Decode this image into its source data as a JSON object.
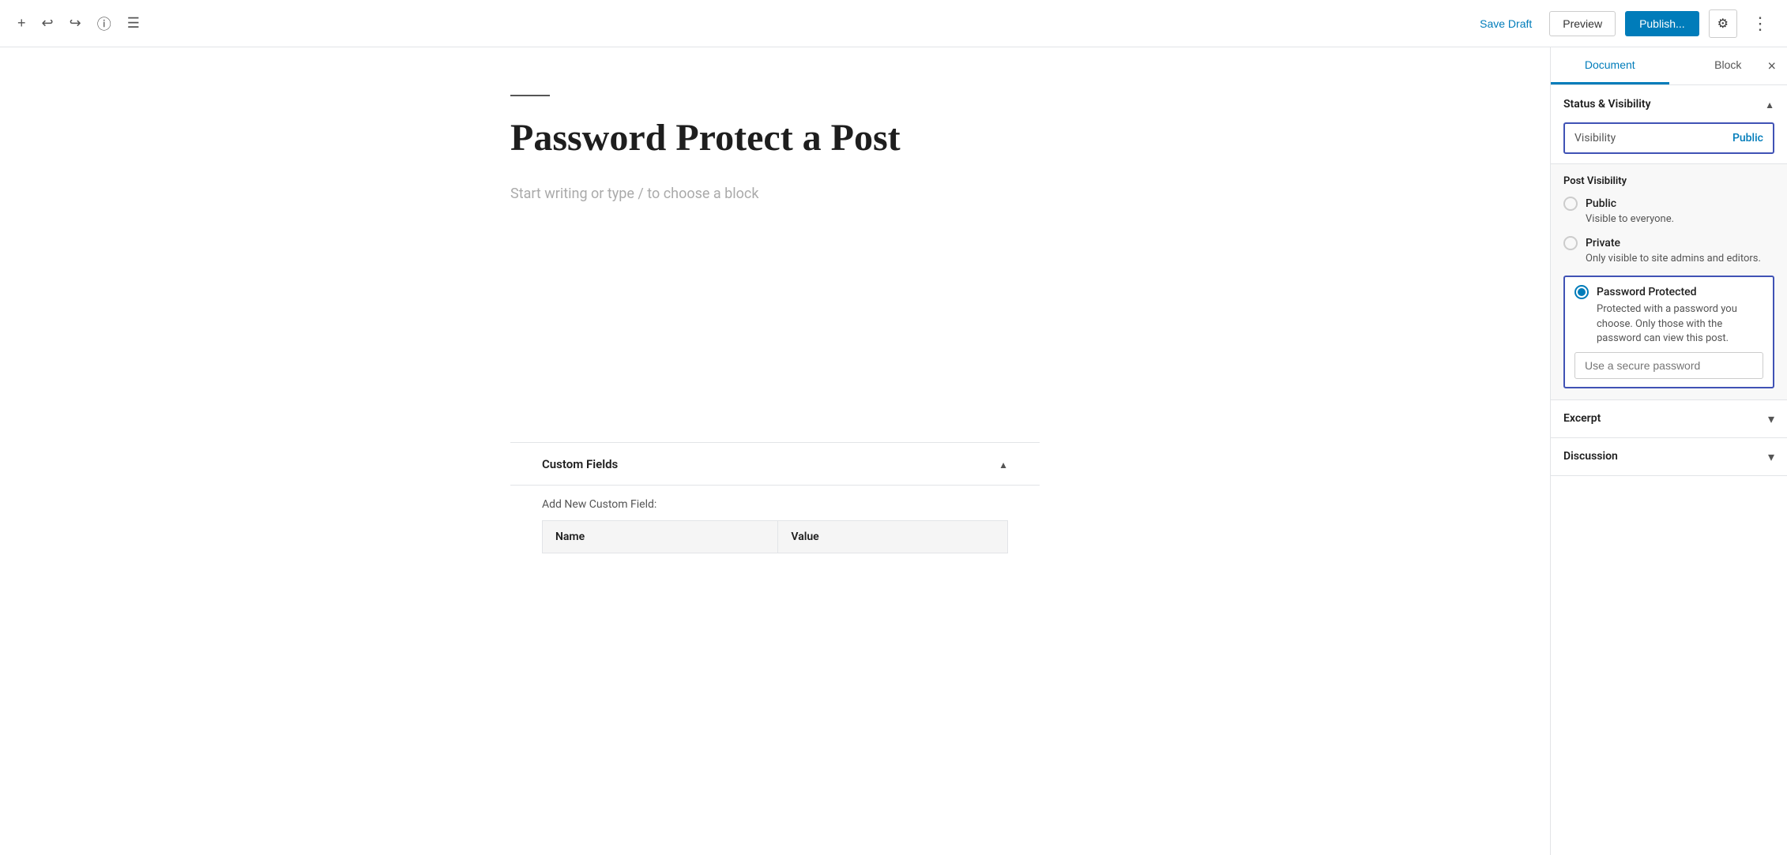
{
  "toolbar": {
    "save_draft_label": "Save Draft",
    "preview_label": "Preview",
    "publish_label": "Publish...",
    "settings_icon": "⚙",
    "more_icon": "⋮",
    "undo_icon": "↩",
    "redo_icon": "↪",
    "info_icon": "ⓘ",
    "list_icon": "☰",
    "add_icon": "+"
  },
  "editor": {
    "divider": true,
    "post_title": "Password Protect a Post",
    "placeholder": "Start writing or type / to choose a block",
    "custom_fields": {
      "title": "Custom Fields",
      "add_label": "Add New Custom Field:",
      "columns": [
        "Name",
        "Value"
      ]
    }
  },
  "sidebar": {
    "tabs": [
      {
        "id": "document",
        "label": "Document",
        "active": true
      },
      {
        "id": "block",
        "label": "Block",
        "active": false
      }
    ],
    "close_label": "×",
    "status_visibility": {
      "title": "Status & Visibility",
      "visibility_label": "Visibility",
      "visibility_value": "Public",
      "post_visibility_title": "Post Visibility",
      "options": [
        {
          "id": "public",
          "name": "Public",
          "desc": "Visible to everyone.",
          "selected": false
        },
        {
          "id": "private",
          "name": "Private",
          "desc": "Only visible to site admins and editors.",
          "selected": false
        },
        {
          "id": "password-protected",
          "name": "Password Protected",
          "desc": "Protected with a password you choose. Only those with the password can view this post.",
          "selected": true,
          "password_placeholder": "Use a secure password"
        }
      ]
    },
    "excerpt": {
      "title": "Excerpt"
    },
    "discussion": {
      "title": "Discussion"
    }
  }
}
